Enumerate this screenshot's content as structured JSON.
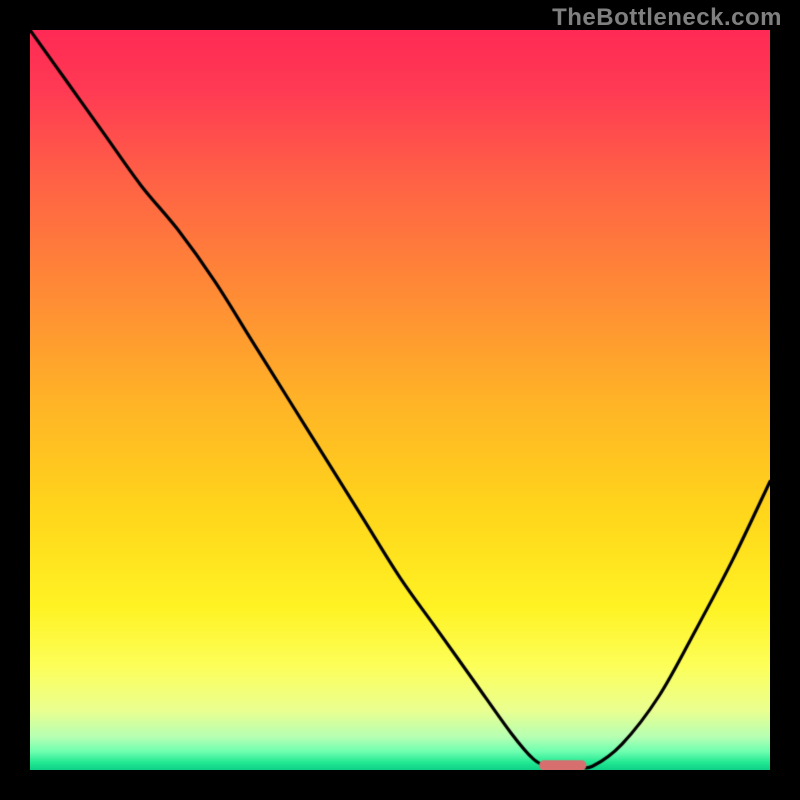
{
  "watermark": "TheBottleneck.com",
  "chart_data": {
    "type": "line",
    "title": "",
    "xlabel": "",
    "ylabel": "",
    "xlim": [
      0,
      100
    ],
    "ylim": [
      0,
      100
    ],
    "series": [
      {
        "name": "curve",
        "x": [
          0,
          5,
          10,
          15,
          20,
          25,
          30,
          35,
          40,
          45,
          50,
          55,
          60,
          65,
          68,
          70,
          72,
          74,
          76,
          80,
          85,
          90,
          95,
          100
        ],
        "y": [
          100,
          93,
          86,
          79,
          73,
          66,
          58,
          50,
          42,
          34,
          26,
          19,
          12,
          5,
          1.5,
          0.5,
          0.5,
          0.5,
          0.5,
          3.5,
          10,
          19,
          28.5,
          39
        ]
      }
    ],
    "marker": {
      "x_center": 72,
      "x_halfwidth": 3.2,
      "y": 0.5,
      "color": "#d86f6f"
    },
    "gradient_stops": [
      {
        "pos": 0.0,
        "color": "#ff2a55"
      },
      {
        "pos": 0.08,
        "color": "#ff3a54"
      },
      {
        "pos": 0.2,
        "color": "#ff6146"
      },
      {
        "pos": 0.35,
        "color": "#ff8a36"
      },
      {
        "pos": 0.5,
        "color": "#ffb327"
      },
      {
        "pos": 0.65,
        "color": "#ffd61b"
      },
      {
        "pos": 0.78,
        "color": "#fff324"
      },
      {
        "pos": 0.86,
        "color": "#fdff5a"
      },
      {
        "pos": 0.92,
        "color": "#eaff91"
      },
      {
        "pos": 0.955,
        "color": "#b7ffb3"
      },
      {
        "pos": 0.975,
        "color": "#6fffb0"
      },
      {
        "pos": 0.99,
        "color": "#21e993"
      },
      {
        "pos": 1.0,
        "color": "#0fd086"
      }
    ],
    "curve_stroke": "#000000",
    "curve_width": 3.2
  }
}
